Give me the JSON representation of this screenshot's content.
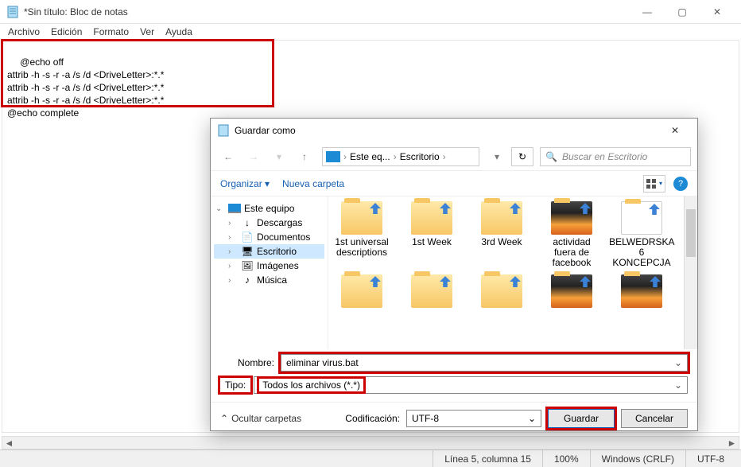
{
  "window": {
    "title": "*Sin título: Bloc de notas",
    "min": "—",
    "max": "▢",
    "close": "✕"
  },
  "menu": {
    "file": "Archivo",
    "edit": "Edición",
    "format": "Formato",
    "view": "Ver",
    "help": "Ayuda"
  },
  "editor_text": "@echo off\nattrib -h -s -r -a /s /d <DriveLetter>:*.*\nattrib -h -s -r -a /s /d <DriveLetter>:*.*\nattrib -h -s -r -a /s /d <DriveLetter>:*.*\n@echo complete",
  "status": {
    "pos": "Línea 5, columna 15",
    "zoom": "100%",
    "eol": "Windows (CRLF)",
    "enc": "UTF-8"
  },
  "dialog": {
    "title": "Guardar como",
    "close": "✕",
    "breadcrumb": {
      "root": "Este eq...",
      "sep": "›",
      "current": "Escritorio"
    },
    "refresh_icon": "↻",
    "search": {
      "placeholder": "Buscar en Escritorio",
      "icon": "🔍"
    },
    "toolbar": {
      "organize": "Organizar ▾",
      "newfolder": "Nueva carpeta",
      "help": "?"
    },
    "tree": {
      "root": "Este equipo",
      "items": [
        {
          "label": "Descargas",
          "icon": "↓"
        },
        {
          "label": "Documentos",
          "icon": "📄"
        },
        {
          "label": "Escritorio",
          "icon": "🖥",
          "selected": true
        },
        {
          "label": "Imágenes",
          "icon": "🖼"
        },
        {
          "label": "Música",
          "icon": "♪"
        }
      ]
    },
    "folders": [
      {
        "label": "1st universal descriptions"
      },
      {
        "label": "1st Week"
      },
      {
        "label": "3rd Week"
      },
      {
        "label": "actividad fuera de facebook",
        "dark": true
      },
      {
        "label": "BELWEDRSKA 6 KONCEPCJA",
        "white": true
      },
      {
        "label": ""
      },
      {
        "label": ""
      },
      {
        "label": ""
      },
      {
        "label": "",
        "dark": true
      },
      {
        "label": "",
        "dark": true
      }
    ],
    "fields": {
      "name_label": "Nombre:",
      "name_value": "eliminar virus.bat",
      "type_label": "Tipo:",
      "type_value": "Todos los archivos  (*.*)"
    },
    "footer": {
      "hide": "Ocultar carpetas",
      "chev": "⌃",
      "enc_label": "Codificación:",
      "enc_value": "UTF-8",
      "save": "Guardar",
      "cancel": "Cancelar"
    }
  }
}
